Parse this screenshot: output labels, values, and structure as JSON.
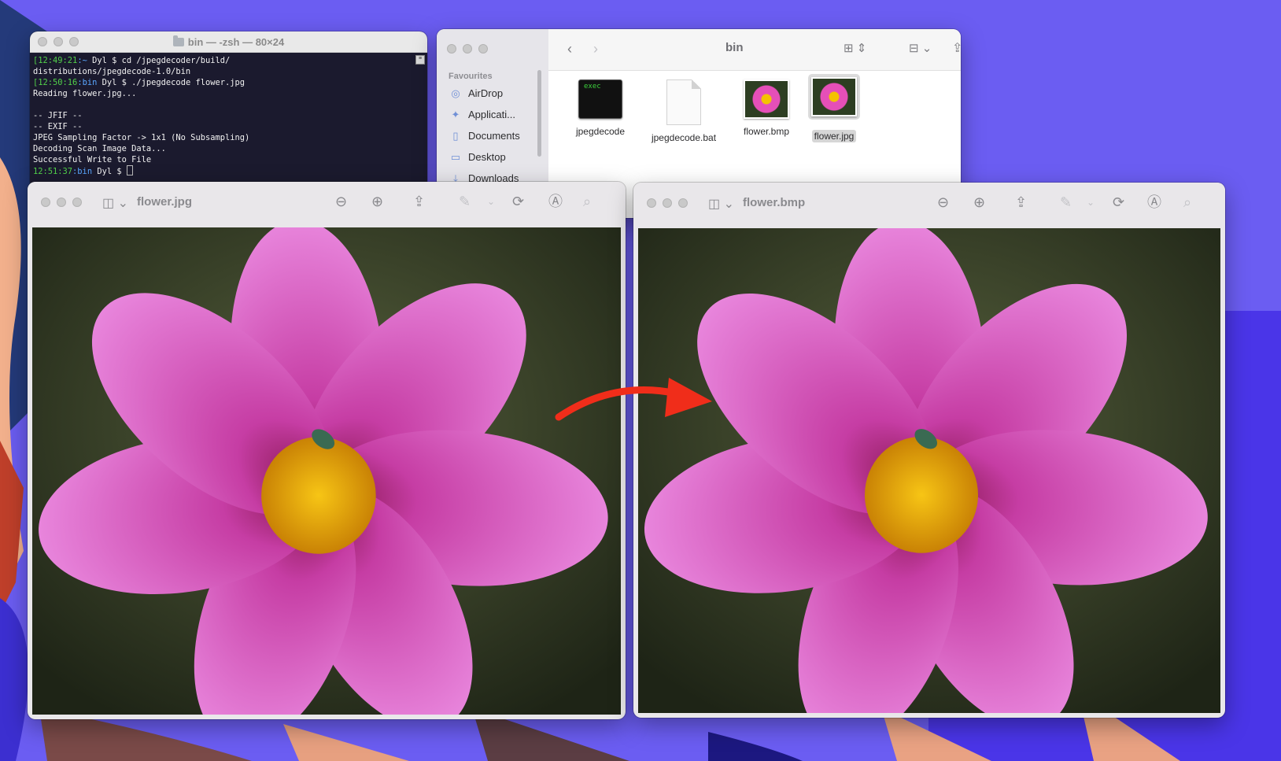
{
  "terminal": {
    "title": "bin — -zsh — 80×24",
    "lines": [
      {
        "time": "[12:49:21",
        "path": ":~",
        "rest": " Dyl $ cd /jpegdecoder/build/"
      },
      {
        "time": "",
        "path": "",
        "rest": "distributions/jpegdecode-1.0/bin"
      },
      {
        "time": "[12:50:16",
        "path": ":bin",
        "rest": " Dyl $ ./jpegdecode flower.jpg"
      },
      {
        "time": "",
        "path": "",
        "rest": "Reading flower.jpg..."
      },
      {
        "time": "",
        "path": "",
        "rest": ""
      },
      {
        "time": "",
        "path": "",
        "rest": "-- JFIF --"
      },
      {
        "time": "",
        "path": "",
        "rest": "-- EXIF --"
      },
      {
        "time": "",
        "path": "",
        "rest": "JPEG Sampling Factor -> 1x1 (No Subsampling)"
      },
      {
        "time": "",
        "path": "",
        "rest": "Decoding Scan Image Data..."
      },
      {
        "time": "",
        "path": "",
        "rest": "Successful Write to File"
      },
      {
        "time": "12:51:37",
        "path": ":bin",
        "rest": " Dyl $ "
      }
    ]
  },
  "finder": {
    "folder": "bin",
    "favourites_heading": "Favourites",
    "sidebar": [
      "AirDrop",
      "Applicati...",
      "Documents",
      "Desktop",
      "Downloads"
    ],
    "files": [
      {
        "name": "jpegdecode",
        "kind": "exec",
        "thumb_label": "exec"
      },
      {
        "name": "jpegdecode.bat",
        "kind": "doc"
      },
      {
        "name": "flower.bmp",
        "kind": "image"
      },
      {
        "name": "flower.jpg",
        "kind": "image",
        "selected": true
      }
    ]
  },
  "preview_left": {
    "title": "flower.jpg"
  },
  "preview_right": {
    "title": "flower.bmp"
  },
  "colors": {
    "arrow": "#f02d1a",
    "petal": "#d85fc9",
    "center": "#f2b705"
  }
}
